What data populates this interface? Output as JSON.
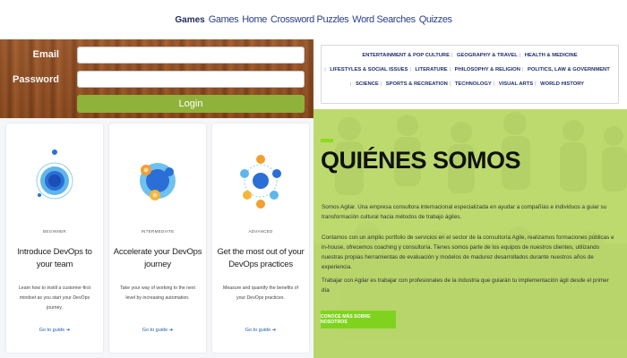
{
  "topnav": {
    "brand": "Games",
    "links": [
      "Games",
      "Home",
      "Crossword Puzzles",
      "Word Searches",
      "Quizzes"
    ]
  },
  "login": {
    "email_label": "Email",
    "password_label": "Password",
    "email_value": "",
    "password_value": "",
    "button_label": "Login"
  },
  "cards": [
    {
      "level": "BEGINNER",
      "title": "Introduce DevOps to your team",
      "desc": "Learn how to instill a customer-first mindset as you start your DevOps journey.",
      "link": "Go to guide"
    },
    {
      "level": "INTERMEDIATE",
      "title": "Accelerate your DevOps journey",
      "desc": "Take your way of working to the next level by increasing automation.",
      "link": "Go to guide"
    },
    {
      "level": "ADVANCED",
      "title": "Get the most out of your DevOps practices",
      "desc": "Measure and quantify the benefits of your DevOps practices.",
      "link": "Go to guide"
    }
  ],
  "categories": [
    "ENTERTAINMENT & POP CULTURE",
    "GEOGRAPHY & TRAVEL",
    "HEALTH & MEDICINE",
    "LIFESTYLES & SOCIAL ISSUES",
    "LITERATURE",
    "PHILOSOPHY & RELIGION",
    "POLITICS, LAW & GOVERNMENT",
    "SCIENCE",
    "SPORTS & RECREATION",
    "TECHNOLOGY",
    "VISUAL ARTS",
    "WORLD HISTORY"
  ],
  "about": {
    "heading": "QUIÉNES SOMOS",
    "p1": "Somos Agilar. Una empresa consultora internacional especializada en ayudar a compañías e individuos a guiar su transformación cultural hacia métodos de trabajo ágiles.",
    "p2": "Contamos con un amplio portfolio de servicios en el sector de la consultoría Agile, realizamos formaciones públicas e in-house, ofrecemos coaching y consultoría. Tienes somos parte de los equipos de nuestros clientes, utilizando nuestras propias herramientas de evaluación y modelos de madurez desarrollados durante nuestros años de experiencia.",
    "p3": "Trabajar con Agilar es trabajar con profesionales de la industria que guiarán tu implementación ágil desde el primer día",
    "cta": "CONOCE MÁS SOBRE NOSOTROS"
  },
  "colors": {
    "wood": "#8a4a1f",
    "login_button": "#8fb23a",
    "nav_text": "#2a3f8f",
    "about_accent": "#7fd31f",
    "link_blue": "#1f5fb0"
  }
}
